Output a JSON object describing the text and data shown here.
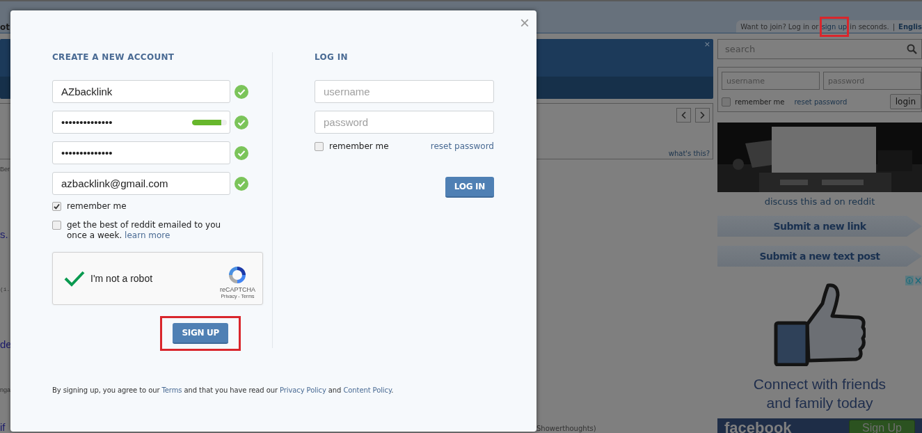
{
  "header": {
    "tab_fragment": "ot",
    "user_bar": {
      "prefix": "Want to join? Log in or",
      "signup_link": {
        "label": "sign up",
        "highlighted": true
      },
      "suffix": "in seconds.",
      "separator": "|",
      "language": "Englis"
    }
  },
  "banner": {
    "close": "×"
  },
  "carousel": {
    "whats_this": "what's this?"
  },
  "listing_fragments": [
    {
      "kind": "small",
      "text": "Ber"
    },
    {
      "kind": "title",
      "text": "s."
    },
    {
      "kind": "mono",
      "text": "(i."
    },
    {
      "kind": "title",
      "text": "de"
    },
    {
      "kind": "small",
      "text": "nga"
    },
    {
      "kind": "title",
      "text": "if",
      "subreddit": "Showerthoughts)"
    }
  ],
  "sidebar": {
    "search": {
      "placeholder": "search"
    },
    "login": {
      "username_placeholder": "username",
      "password_placeholder": "password",
      "remember": {
        "label": "remember me",
        "checked": false
      },
      "reset_link": "reset password",
      "button": "login"
    },
    "ad": {
      "kind": "picture",
      "caption": "discuss this ad on reddit"
    },
    "submit_buttons": [
      "Submit a new link",
      "Submit a new text post"
    ],
    "promo": {
      "headline": "Connect with friends and family today",
      "brand": "facebook",
      "button": "Sign Up"
    }
  },
  "modal": {
    "close": "×",
    "signup": {
      "title": "CREATE A NEW ACCOUNT",
      "fields": [
        {
          "value": "AZbacklink",
          "valid": true
        },
        {
          "value": "••••••••••••••",
          "level": 0.84,
          "valid": true
        },
        {
          "value": "••••••••••••••",
          "valid": true
        },
        {
          "value": "azbacklink@gmail.com",
          "valid": true
        }
      ],
      "options": [
        {
          "label": "remember me",
          "checked": true
        },
        {
          "label": "get the best of reddit emailed to you once a week.",
          "link": "learn more",
          "checked": false
        }
      ],
      "captcha": {
        "label": "I'm not a robot",
        "checked": true,
        "brand": "reCAPTCHA",
        "links": "Privacy - Terms"
      },
      "button": {
        "label": "SIGN UP",
        "highlighted": true
      },
      "legal": [
        {
          "kind": "text",
          "text": "By signing up, you agree to our "
        },
        {
          "kind": "link",
          "text": "Terms"
        },
        {
          "kind": "text",
          "text": " and that you have read our "
        },
        {
          "kind": "link",
          "text": "Privacy Policy"
        },
        {
          "kind": "text",
          "text": " and "
        },
        {
          "kind": "link",
          "text": "Content Policy"
        },
        {
          "kind": "text",
          "text": "."
        }
      ]
    },
    "login": {
      "title": "LOG IN",
      "fields": [
        {
          "placeholder": "username"
        },
        {
          "placeholder": "password"
        }
      ],
      "remember": {
        "label": "remember me",
        "checked": false
      },
      "reset_link": "reset password",
      "button": "LOG IN"
    }
  }
}
